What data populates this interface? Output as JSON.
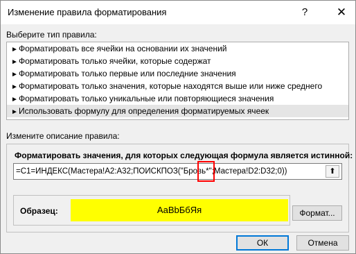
{
  "window": {
    "title": "Изменение правила форматирования",
    "help_glyph": "?",
    "close_glyph": "✕"
  },
  "rule_type": {
    "label": "Выберите тип правила:",
    "items": [
      {
        "label": "Форматировать все ячейки на основании их значений"
      },
      {
        "label": "Форматировать только ячейки, которые содержат"
      },
      {
        "label": "Форматировать только первые или последние значения"
      },
      {
        "label": "Форматировать только значения, которые находятся выше или ниже среднего"
      },
      {
        "label": "Форматировать только уникальные или повторяющиеся значения"
      },
      {
        "label": "Использовать формулу для определения форматируемых ячеек",
        "selected": true
      }
    ],
    "arrow_glyph": "►"
  },
  "description": {
    "label": "Измените описание правила:",
    "formula_caption": "Форматировать значения, для которых следующая формула является истинной:",
    "formula_value": "=C1=ИНДЕКС(Мастера!A2:A32;ПОИСКПОЗ(\"Бровь*\";Мастера!D2:D32;0))",
    "collapse_glyph": "⬆",
    "preview_label": "Образец:",
    "preview_text": "АаВbБбЯя",
    "preview_color": "#ffff00",
    "format_button": "Формат..."
  },
  "buttons": {
    "ok": "ОК",
    "cancel": "Отмена"
  },
  "colors": {
    "highlight": "#ff0000",
    "focus_border": "#0078d7"
  }
}
